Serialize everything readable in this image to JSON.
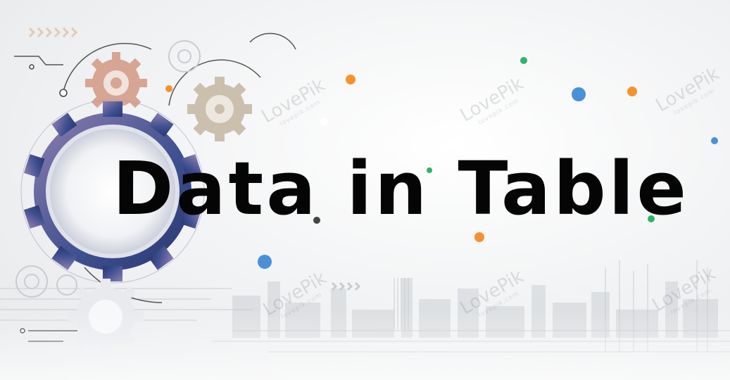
{
  "banner": {
    "headline": "Data in Table",
    "watermark_text": "LovePik",
    "watermark_sub": "lovepik.com"
  },
  "decor": {
    "icons": [
      "gear-icon",
      "circuit-lines",
      "arrow-chevrons",
      "colored-dots"
    ],
    "colors": {
      "gear_blue": "#3e4f8f",
      "gear_purple": "#7b6ea6",
      "gear_salmon": "#c98a74",
      "dot_orange": "#f5922e",
      "dot_green": "#2fb36b",
      "dot_blue": "#4a90d9"
    }
  }
}
